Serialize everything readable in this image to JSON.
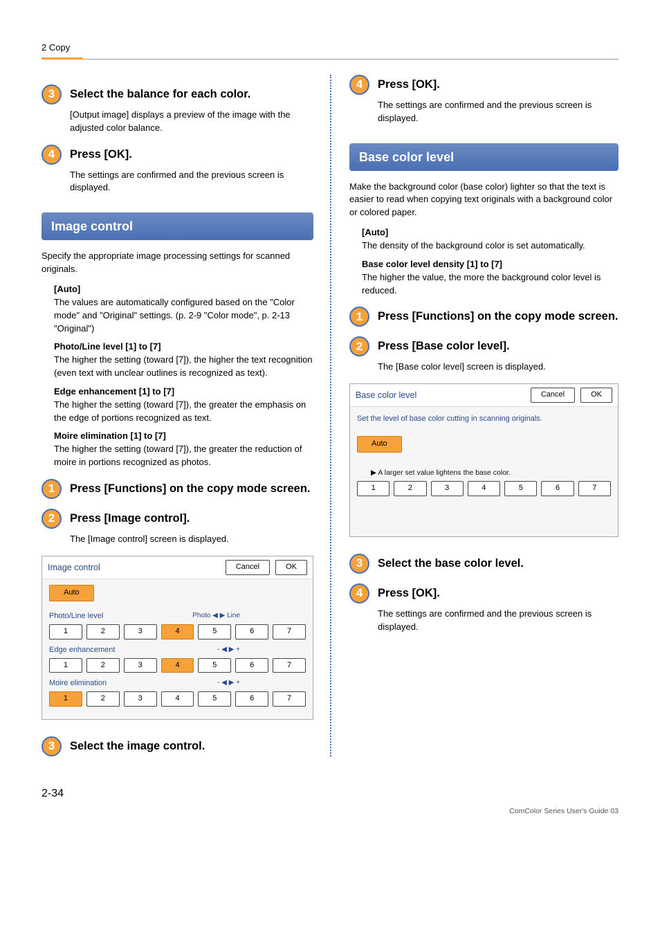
{
  "header": {
    "breadcrumb": "2 Copy"
  },
  "left": {
    "step3": {
      "num": "3",
      "title": "Select the balance for each color.",
      "body": "[Output image] displays a preview of the image with the adjusted color balance."
    },
    "step4": {
      "num": "4",
      "title": "Press [OK].",
      "body": "The settings are confirmed and the previous screen is displayed."
    },
    "section_title": "Image control",
    "intro": "Specify the appropriate image processing settings for scanned originals.",
    "defs": {
      "auto_label": "[Auto]",
      "auto_body": "The values are automatically configured based on the \"Color mode\" and \"Original\" settings. (p. 2-9 \"Color mode\", p. 2-13 \"Original\")",
      "pl_label": "Photo/Line level [1] to [7]",
      "pl_body": "The higher the setting (toward [7]), the higher the text recognition (even text with unclear outlines is recognized as text).",
      "ee_label": "Edge enhancement [1] to [7]",
      "ee_body": "The higher the setting (toward [7]), the greater the emphasis on the edge of portions recognized as text.",
      "me_label": "Moire elimination [1] to [7]",
      "me_body": "The higher the setting (toward [7]), the greater the reduction of moire in portions recognized as photos."
    },
    "steps2": {
      "s1": {
        "num": "1",
        "title": "Press [Functions] on the copy mode screen."
      },
      "s2": {
        "num": "2",
        "title": "Press [Image control].",
        "body": "The [Image control] screen is displayed."
      },
      "s3": {
        "num": "3",
        "title": "Select the image control."
      }
    },
    "screenshot": {
      "title": "Image control",
      "cancel": "Cancel",
      "ok": "OK",
      "auto": "Auto",
      "row1_label": "Photo/Line level",
      "row1_right": "Photo ◀ ▶ Line",
      "row2_label": "Edge enhancement",
      "row2_right": "- ◀ ▶ +",
      "row3_label": "Moire elimination",
      "row3_right": "- ◀ ▶ +",
      "levels": [
        "1",
        "2",
        "3",
        "4",
        "5",
        "6",
        "7"
      ],
      "row1_sel": 4,
      "row2_sel": 4,
      "row3_sel": 1
    }
  },
  "right": {
    "step4top": {
      "num": "4",
      "title": "Press [OK].",
      "body": "The settings are confirmed and the previous screen is displayed."
    },
    "section_title": "Base color level",
    "intro": "Make the background color (base color) lighter so that the text is easier to read when copying text originals with a background color or colored paper.",
    "defs": {
      "auto_label": "[Auto]",
      "auto_body": "The density of the background color is set automatically.",
      "bc_label": "Base color level density [1] to [7]",
      "bc_body": "The higher the value, the more the background color level is reduced."
    },
    "steps": {
      "s1": {
        "num": "1",
        "title": "Press [Functions] on the copy mode screen."
      },
      "s2": {
        "num": "2",
        "title": "Press [Base color level].",
        "body": "The [Base color level] screen is displayed."
      },
      "s3": {
        "num": "3",
        "title": "Select the base color level."
      },
      "s4": {
        "num": "4",
        "title": "Press [OK].",
        "body": "The settings are confirmed and the previous screen is displayed."
      }
    },
    "screenshot": {
      "title": "Base color level",
      "cancel": "Cancel",
      "ok": "OK",
      "msg": "Set the level of base color cutting in scanning originals.",
      "auto": "Auto",
      "hint": "▶ A larger set value lightens the base color.",
      "levels": [
        "1",
        "2",
        "3",
        "4",
        "5",
        "6",
        "7"
      ],
      "sel": 0
    }
  },
  "pagenum": "2-34",
  "footer": "ComColor Series User's Guide 03"
}
